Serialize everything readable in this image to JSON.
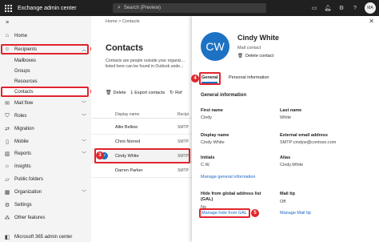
{
  "topbar": {
    "app_title": "Exchange admin center",
    "search_placeholder": "Search (Preview)",
    "icons": [
      "waffle-icon",
      "search-icon",
      "monitor-icon",
      "bell-icon",
      "gear-icon",
      "help-icon"
    ],
    "user_initials": "MA"
  },
  "nav": {
    "items": [
      {
        "label": "Home",
        "icon": "home-icon"
      },
      {
        "label": "Recipients",
        "icon": "person-icon"
      },
      {
        "label": "Mailboxes"
      },
      {
        "label": "Groups"
      },
      {
        "label": "Resources"
      },
      {
        "label": "Contacts"
      },
      {
        "label": "Mail flow",
        "icon": "mail-icon"
      },
      {
        "label": "Roles",
        "icon": "shield-icon"
      },
      {
        "label": "Migration",
        "icon": "migration-icon"
      },
      {
        "label": "Mobile",
        "icon": "mobile-icon"
      },
      {
        "label": "Reports",
        "icon": "chart-icon"
      },
      {
        "label": "Insights",
        "icon": "lightbulb-icon"
      },
      {
        "label": "Public folders",
        "icon": "folder-icon"
      },
      {
        "label": "Organization",
        "icon": "building-icon"
      },
      {
        "label": "Settings",
        "icon": "gear-icon"
      },
      {
        "label": "Other features",
        "icon": "grid-icon"
      },
      {
        "label": "Microsoft 365 admin center",
        "icon": "office-icon"
      }
    ],
    "badges": [
      "1",
      "2"
    ]
  },
  "main": {
    "breadcrumb": "Home  >  Contacts",
    "title": "Contacts",
    "description": "Contacts are people outside your organiz... listed here can be found in Outlook unde...",
    "toolbar": {
      "delete": "Delete",
      "export": "Export contacts",
      "refresh": "Ref"
    },
    "columns": {
      "name": "Display name",
      "type": "Recipi"
    },
    "rows": [
      {
        "name": "Allie Bellew",
        "type": "SMTP"
      },
      {
        "name": "Chris Norred",
        "type": "SMTP"
      },
      {
        "name": "Cindy White",
        "type": "SMTP"
      },
      {
        "name": "Darren Parker",
        "type": "SMTP"
      }
    ],
    "badge": "3"
  },
  "panel": {
    "initials": "CW",
    "name": "Cindy White",
    "type": "Mail contact",
    "delete": "Delete contact",
    "tabs": {
      "general": "General",
      "personal": "Personal information"
    },
    "badge_tab": "4",
    "section": "General information",
    "fields": {
      "first_name_label": "First name",
      "first_name": "Cindy",
      "last_name_label": "Last name",
      "last_name": "White",
      "display_label": "Display name",
      "display": "Cindy White",
      "email_label": "External email address",
      "email": "SMTP:cindyw@contoso.com",
      "initials_label": "Initials",
      "initials": "C.W.",
      "alias_label": "Alias",
      "alias": "Cindy.White",
      "manage_general": "Manage general information",
      "hide_label": "Hide from global address list (GAL)",
      "hide": "No",
      "mailtip_label": "Mail tip",
      "mailtip": "Off",
      "manage_hide": "Manage hide from GAL",
      "manage_mailtip": "Manage Mail tip"
    },
    "badge_link": "5"
  }
}
